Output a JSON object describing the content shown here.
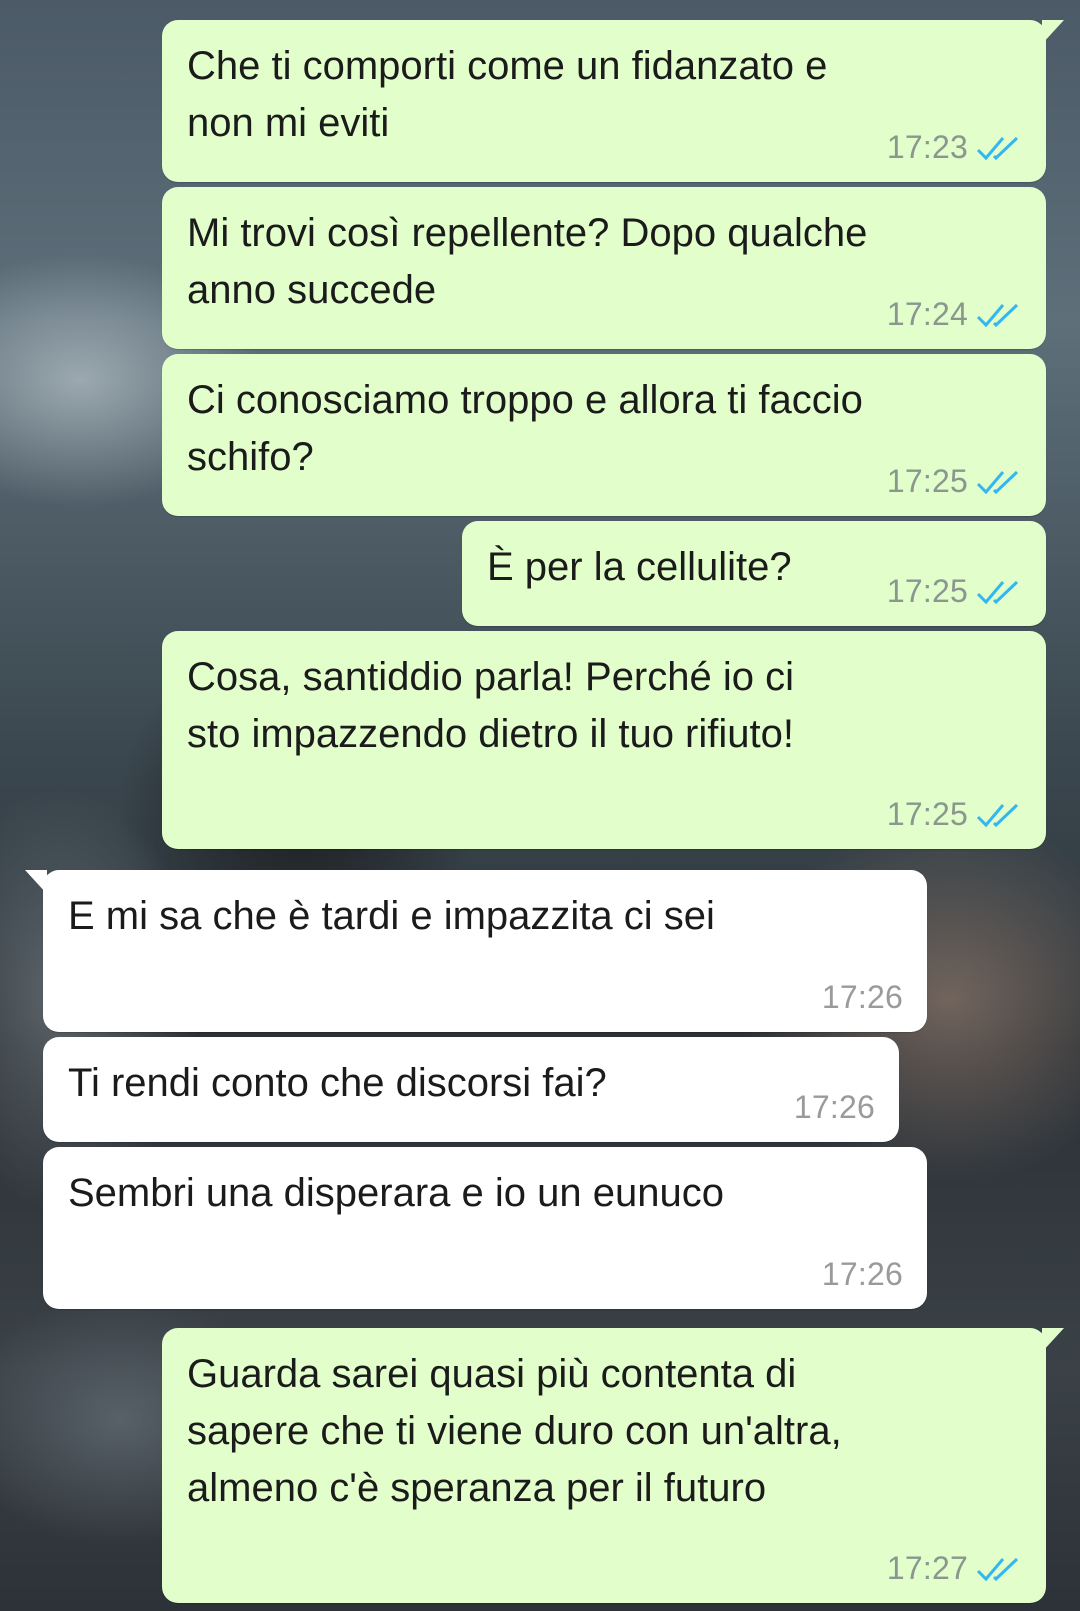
{
  "messages": [
    {
      "direction": "outgoing",
      "text": "Che ti comporti come un fidanzato e\nnon mi eviti",
      "time": "17:23",
      "status_icon": "double-check-read-icon"
    },
    {
      "direction": "outgoing",
      "text": "Mi trovi così repellente? Dopo qualche\nanno succede",
      "time": "17:24",
      "status_icon": "double-check-read-icon"
    },
    {
      "direction": "outgoing",
      "text": "Ci conosciamo troppo e allora ti faccio\nschifo?",
      "time": "17:25",
      "status_icon": "double-check-read-icon"
    },
    {
      "direction": "outgoing",
      "text": "È per la cellulite?",
      "time": "17:25",
      "status_icon": "double-check-read-icon"
    },
    {
      "direction": "outgoing",
      "text": "Cosa, santiddio parla! Perché io ci\nsto impazzendo dietro il tuo rifiuto!",
      "time": "17:25",
      "status_icon": "double-check-read-icon"
    },
    {
      "direction": "incoming",
      "text": "E mi sa che è tardi e impazzita ci sei",
      "time": "17:26"
    },
    {
      "direction": "incoming",
      "text": "Ti rendi conto che discorsi fai?",
      "time": "17:26"
    },
    {
      "direction": "incoming",
      "text": "Sembri una disperara e io un eunuco",
      "time": "17:26"
    },
    {
      "direction": "outgoing",
      "text": "Guarda sarei quasi più contenta di\nsapere che ti viene duro con un'altra,\nalmeno c'è speranza per il futuro",
      "time": "17:27",
      "status_icon": "double-check-read-icon"
    }
  ],
  "colors": {
    "outgoing_bubble": "#e1fecb",
    "incoming_bubble": "#ffffff",
    "read_tick": "#34b7f1"
  }
}
